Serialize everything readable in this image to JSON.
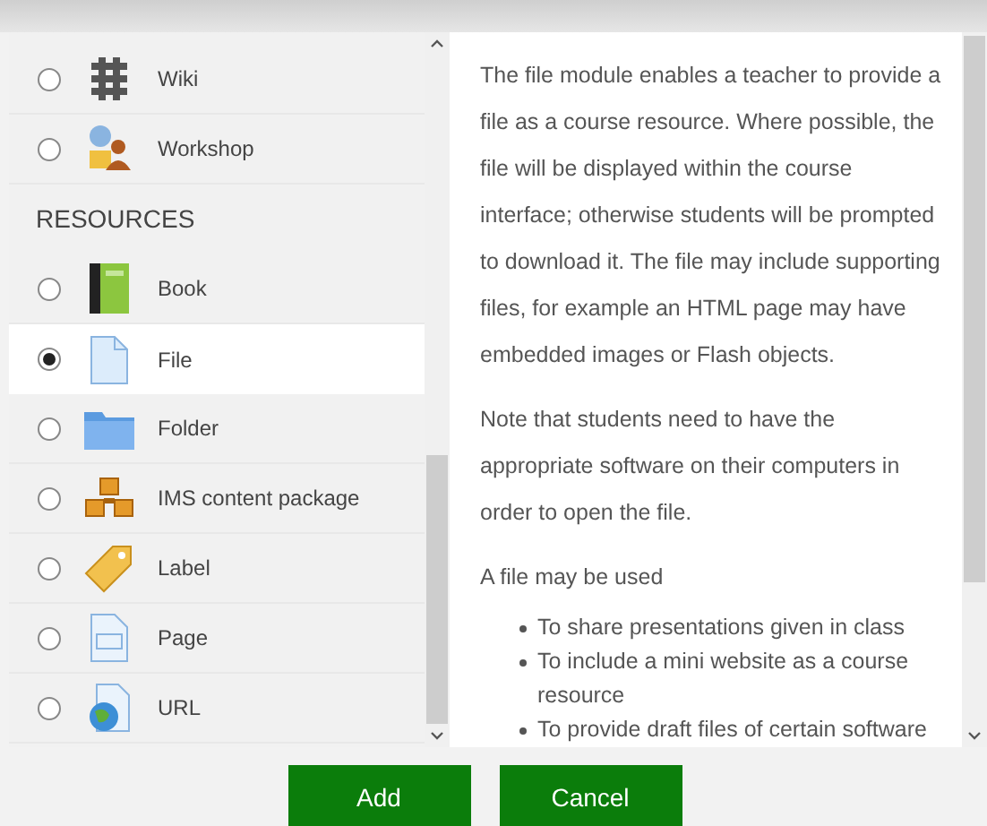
{
  "modules": [
    {
      "kind": "module",
      "label": "Wiki",
      "selected": false
    },
    {
      "kind": "module",
      "label": "Workshop",
      "selected": false
    },
    {
      "kind": "heading",
      "label": "RESOURCES"
    },
    {
      "kind": "module",
      "label": "Book",
      "selected": false
    },
    {
      "kind": "module",
      "label": "File",
      "selected": true
    },
    {
      "kind": "module",
      "label": "Folder",
      "selected": false
    },
    {
      "kind": "module",
      "label": "IMS content package",
      "selected": false
    },
    {
      "kind": "module",
      "label": "Label",
      "selected": false
    },
    {
      "kind": "module",
      "label": "Page",
      "selected": false
    },
    {
      "kind": "module",
      "label": "URL",
      "selected": false
    }
  ],
  "description": {
    "paragraphs": [
      "The file module enables a teacher to provide a file as a course resource. Where possible, the file will be displayed within the course interface; otherwise students will be prompted to download it. The file may include supporting files, for example an HTML page may have embedded images or Flash objects.",
      "Note that students need to have the appropriate software on their computers in order to open the file.",
      "A file may be used"
    ],
    "bullets": [
      "To share presentations given in class",
      "To include a mini website as a course resource",
      "To provide draft files of certain software"
    ]
  },
  "buttons": [
    {
      "label": "Add"
    },
    {
      "label": "Cancel"
    }
  ]
}
